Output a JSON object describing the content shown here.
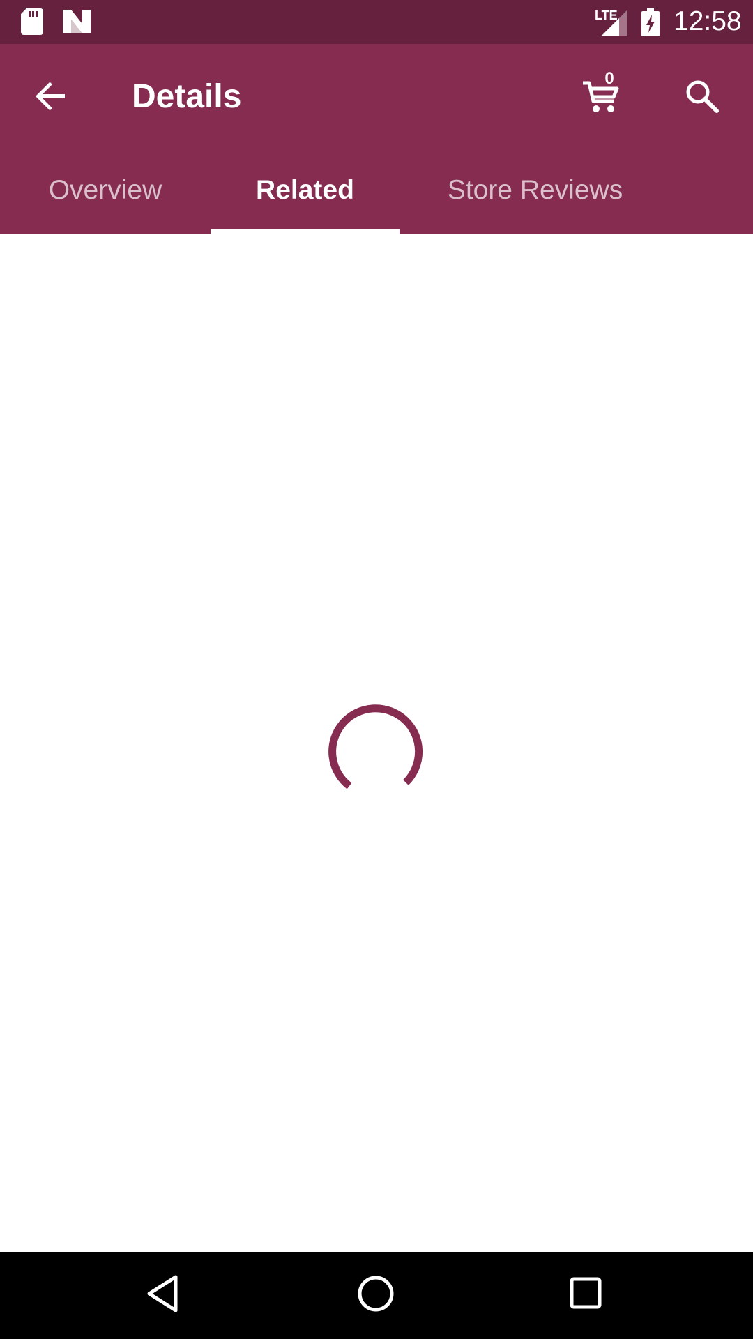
{
  "status_bar": {
    "time": "12:58",
    "network_label": "LTE",
    "icons": [
      "sd-card-icon",
      "n-notification-icon",
      "signal-icon",
      "battery-charging-icon"
    ]
  },
  "app_bar": {
    "title": "Details",
    "cart_count": "0",
    "icons": [
      "back-arrow-icon",
      "cart-icon",
      "search-icon"
    ]
  },
  "tabs": [
    {
      "label": "Overview",
      "active": false
    },
    {
      "label": "Related",
      "active": true
    },
    {
      "label": "Store Reviews",
      "active": false
    }
  ],
  "content": {
    "state": "loading",
    "spinner_icon": "loading-spinner-icon"
  },
  "colors": {
    "status_bar": "#66213f",
    "primary": "#852c50",
    "background": "#ffffff",
    "nav_bar": "#000000"
  },
  "nav_bar": {
    "icons": [
      "nav-back-icon",
      "nav-home-icon",
      "nav-recents-icon"
    ]
  }
}
